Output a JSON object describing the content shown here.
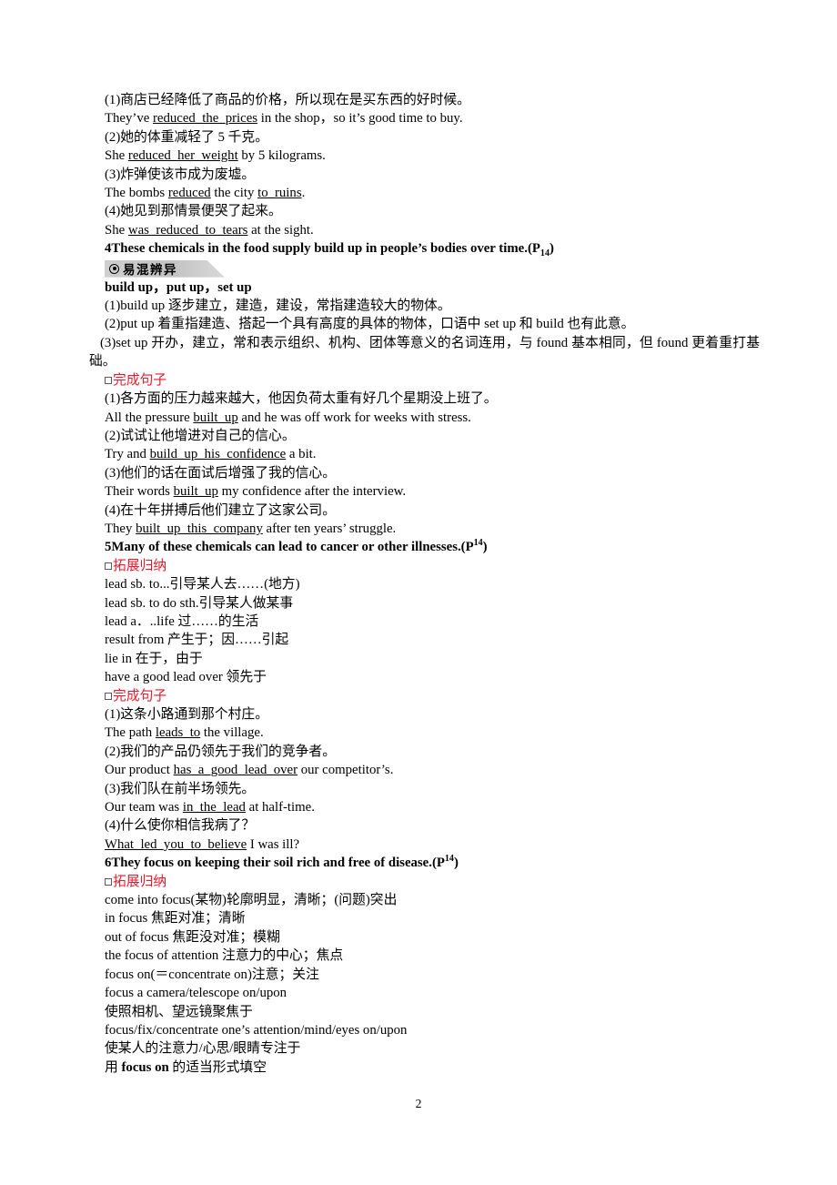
{
  "page": {
    "number": "2",
    "accent_red": "#e8192c",
    "badge_gray": "#c9c9c9"
  },
  "sections": [
    {
      "id": "reduce-examples",
      "lines": [
        "(1)商店已经降低了商品的价格，所以现在是买东西的好时候。",
        "They’ve reduced_the_prices in the shop，so it’s good time to buy.",
        "(2)她的体重减轻了 5 千克。",
        "She reduced_her_weight by 5 kilograms.",
        "(3)炸弹使该市成为废墟。",
        "The bombs reduced the city to_ruins.",
        "(4)她见到那情景便哭了起来。",
        "She was_reduced_to_tears at the sight."
      ]
    }
  ],
  "entry4": {
    "number": "4",
    "sentence": "These chemicals in the food supply build up in people’s bodies over time.",
    "page_ref_open": "(P",
    "page_ref_num": "14",
    "page_ref_close": ")"
  },
  "badge_yihun": {
    "icon": "bullseye-icon",
    "label": "易混辨异"
  },
  "build_up_block": {
    "title": "build up，put up，set up",
    "items": [
      "(1)build up 逐步建立，建造，建设，常指建造较大的物体。",
      "(2)put up 着重指建造、搭起一个具有高度的具体的物体，口语中 set up 和 build 也有此意。"
    ],
    "item3": "(3)set up 开办，建立，常和表示组织、机构、团体等意义的名词连用，与 found 基本相同，但 found 更着重打基础。"
  },
  "exercise_build_up": {
    "heading": "完成句子",
    "lines": [
      "(1)各方面的压力越来越大，他因负荷太重有好几个星期没上班了。",
      "All the pressure built_up and he was off work for weeks with stress.",
      "(2)试试让他增进对自己的信心。",
      "Try and build_up_his_confidence a bit.",
      "(3)他们的话在面试后增强了我的信心。",
      "Their words built_up my confidence after the interview.",
      "(4)在十年拼搏后他们建立了这家公司。",
      "They built_up_this_company after ten years’ struggle."
    ]
  },
  "entry5": {
    "number": "5",
    "sentence": "Many of these chemicals can lead to cancer or other illnesses.",
    "page_ref_open": "(P",
    "page_ref_num": "14",
    "page_ref_close": ")"
  },
  "expand_lead": {
    "heading": "拓展归纳",
    "lines": [
      "lead sb. to...引导某人去……(地方)",
      "lead sb. to do sth.引导某人做某事",
      "lead a．..life 过……的生活",
      "result from 产生于；因……引起",
      "lie in 在于，由于",
      "have a good lead over 领先于"
    ]
  },
  "exercise_lead": {
    "heading": "完成句子",
    "lines": [
      "(1)这条小路通到那个村庄。",
      "The path leads_to the village.",
      "(2)我们的产品仍领先于我们的竞争者。",
      "Our product has_a_good_lead_over our competitor’s.",
      "(3)我们队在前半场领先。",
      "Our team was in_the_lead at half-time.",
      "(4)什么使你相信我病了？",
      "What_led_you_to_believe I was ill?"
    ]
  },
  "entry6": {
    "number": "6",
    "sentence": "They focus on keeping their soil rich and free of disease.",
    "page_ref_open": "(P",
    "page_ref_num": "14",
    "page_ref_close": ")"
  },
  "expand_focus": {
    "heading": "拓展归纳",
    "lines": [
      "come into focus(某物)轮廓明显，清晰；(问题)突出",
      "in focus 焦距对准；清晰",
      "out of focus 焦距没对准；模糊",
      "the focus of attention 注意力的中心；焦点",
      "focus on(＝concentrate on)注意；关注",
      "focus a camera/telescope on/upon",
      "使照相机、望远镜聚焦于",
      "focus/fix/concentrate one’s attention/mind/eyes on/upon",
      "使某人的注意力/心思/眼睛专注于"
    ]
  },
  "focus_task": {
    "prefix": "用 ",
    "keyword": "focus on",
    "suffix": " 的适当形式填空"
  }
}
